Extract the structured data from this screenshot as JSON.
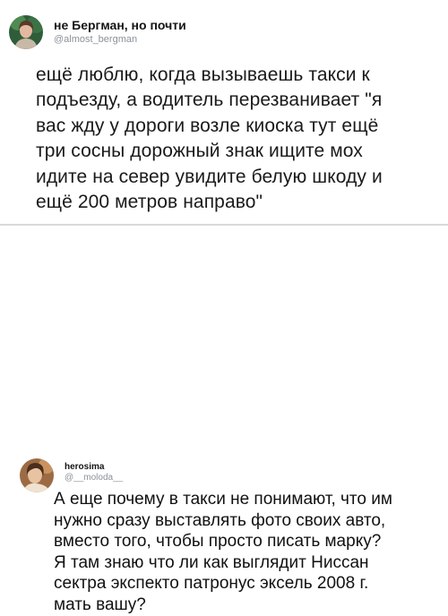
{
  "tweets": [
    {
      "name": "не Бергман, но почти",
      "handle": "@almost_bergman",
      "text": "ещё люблю, когда вызываешь такси к\nподъезду, а водитель перезванивает \"я\nвас жду у дороги возле киоска тут ещё\nтри сосны дорожный знак ищите мох\nидите на север увидите белую шкоду и\nещё 200 метров направо\""
    },
    {
      "name": "herosima",
      "handle": "@__moloda__",
      "text": "А еще почему в такси не понимают, что им\nнужно сразу выставлять фото своих авто,\nвместо того, чтобы просто писать марку?\nЯ там знаю что ли как выглядит Ниссан\nсектра экспекто патронус эксель 2008 г.\nмать вашу?"
    }
  ],
  "colors": {
    "handle": "#8a9299",
    "divider": "#d9d9d9"
  },
  "icons": [
    "avatar-photo",
    "avatar-photo"
  ]
}
